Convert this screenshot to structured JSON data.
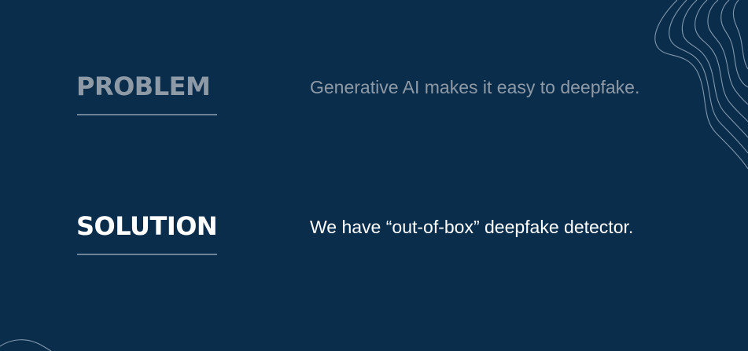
{
  "slide": {
    "problem": {
      "heading": "PROBLEM",
      "text": "Generative AI makes it easy to deepfake."
    },
    "solution": {
      "heading": "SOLUTION",
      "text": "We have “out-of-box” deepfake detector."
    }
  },
  "colors": {
    "background": "#0b2d4c",
    "muted_text": "#8e9aa6",
    "bright_text": "#ffffff",
    "underline": "#6d8398",
    "topo_lines": "#7f97ad"
  },
  "decorations": {
    "top_right": "topographic-contour-lines",
    "bottom_left": "topographic-contour-lines"
  }
}
